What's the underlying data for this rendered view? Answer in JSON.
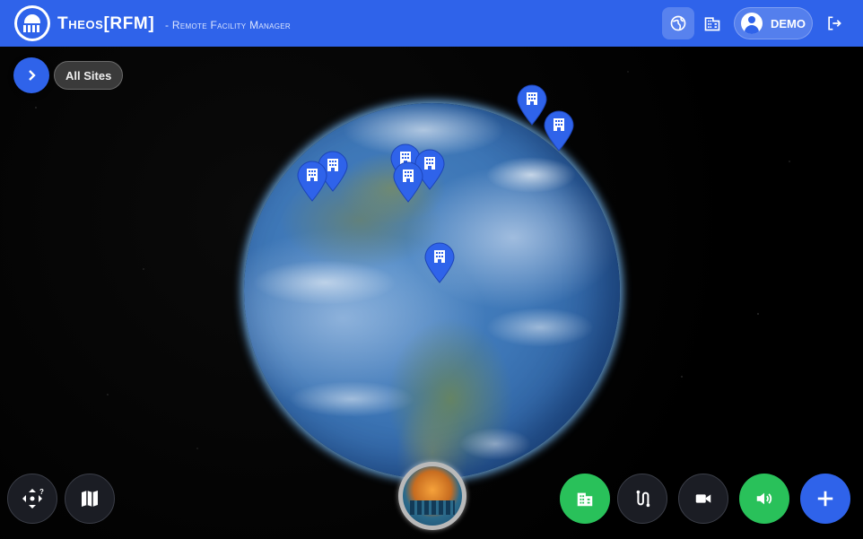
{
  "header": {
    "app_name": "Theos[RFM]",
    "app_subtitle": "- Remote Facility Manager",
    "user_label": "DEMO"
  },
  "toolbar": {
    "all_sites_label": "All Sites"
  },
  "colors": {
    "primary": "#2f63ea",
    "success": "#29c15a",
    "dark_button": "#1b1d24",
    "marker": "#2f63ea"
  },
  "icons": {
    "globe_view": "globe-icon",
    "building_view": "building-icon",
    "logout": "logout-icon",
    "expand": "chevron-right-icon",
    "compass": "move-icon",
    "map": "map-icon",
    "add_site": "building-icon",
    "route": "route-icon",
    "camera": "video-camera-icon",
    "audio": "speaker-icon",
    "add": "plus-icon"
  }
}
